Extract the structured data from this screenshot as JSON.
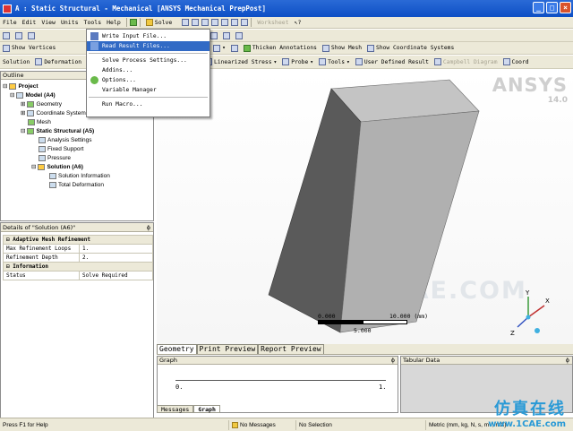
{
  "window": {
    "title": "A : Static Structural - Mechanical [ANSYS Mechanical PrepPost]",
    "min": "_",
    "max": "□",
    "close": "×"
  },
  "menubar": {
    "items": [
      "File",
      "Edit",
      "View",
      "Units",
      "Tools",
      "Help"
    ],
    "solve": "Solve",
    "worksheet": "Worksheet"
  },
  "toolbar1": {
    "show_vertices": "Show Vertices",
    "thicken_annotations": "Thicken Annotations",
    "show_mesh": "Show Mesh",
    "show_coordinate_systems": "Show Coordinate Systems"
  },
  "toolbar2": {
    "solution": "Solution",
    "deformation": "Deformation",
    "linearized_stress": "Linearized Stress",
    "probe": "Probe",
    "tools": "Tools",
    "user_defined_result": "User Defined Result",
    "campbell_diagram": "Campbell Diagram",
    "coordinate": "Coord"
  },
  "tools_menu": {
    "items": [
      "Write Input File...",
      "Read Result Files...",
      "Solve Process Settings...",
      "Addins...",
      "Options...",
      "Variable Manager",
      "Run Macro..."
    ]
  },
  "outline": {
    "header": "Outline",
    "nodes": [
      {
        "label": "Project",
        "level": 0,
        "bold": true
      },
      {
        "label": "Model (A4)",
        "level": 1,
        "bold": true
      },
      {
        "label": "Geometry",
        "level": 2,
        "bold": false
      },
      {
        "label": "Coordinate Systems",
        "level": 2,
        "bold": false
      },
      {
        "label": "Mesh",
        "level": 2,
        "bold": false
      },
      {
        "label": "Static Structural (A5)",
        "level": 2,
        "bold": true
      },
      {
        "label": "Analysis Settings",
        "level": 3,
        "bold": false
      },
      {
        "label": "Fixed Support",
        "level": 3,
        "bold": false
      },
      {
        "label": "Pressure",
        "level": 3,
        "bold": false
      },
      {
        "label": "Solution (A6)",
        "level": 3,
        "bold": true
      },
      {
        "label": "Solution Information",
        "level": 4,
        "bold": false
      },
      {
        "label": "Total Deformation",
        "level": 4,
        "bold": false
      }
    ]
  },
  "details": {
    "header": "Details of \"Solution (A6)\"",
    "pin": "ɸ",
    "sections": [
      {
        "title": "Adaptive Mesh Refinement",
        "rows": [
          [
            "Max Refinement Loops",
            "1."
          ],
          [
            "Refinement Depth",
            "2."
          ]
        ]
      },
      {
        "title": "Information",
        "rows": [
          [
            "Status",
            "Solve Required"
          ]
        ]
      }
    ]
  },
  "viewport": {
    "logo": "ANSYS",
    "version": "14.0",
    "watermark": "1CAE.COM",
    "scale_start": "0.000",
    "scale_mid": "5.000",
    "scale_end": "10.000 (mm)",
    "axis_x": "X",
    "axis_y": "Y",
    "axis_z": "Z"
  },
  "view_tabs": [
    "Geometry",
    "Print Preview",
    "Report Preview"
  ],
  "graph_panel": {
    "header": "Graph",
    "axis_start": "0.",
    "axis_end": "1.",
    "pin": "ɸ"
  },
  "graph_tabs": [
    "Messages",
    "Graph"
  ],
  "tabular_panel": {
    "header": "Tabular Data",
    "pin": "ɸ"
  },
  "statusbar": {
    "help": "Press F1 for Help",
    "messages": "No Messages",
    "selection": "No Selection",
    "units": "Metric (mm, kg, N, s, mV, mA)"
  },
  "site_watermark": {
    "text": "仿真在线",
    "url": "www.1CAE.com"
  },
  "colors": {
    "titlebar": "#0d4fc5",
    "menu_highlight": "#316ac5",
    "chrome": "#ece9d8",
    "body_dark": "#4a4a4a",
    "body_light": "#b8b8b8"
  }
}
